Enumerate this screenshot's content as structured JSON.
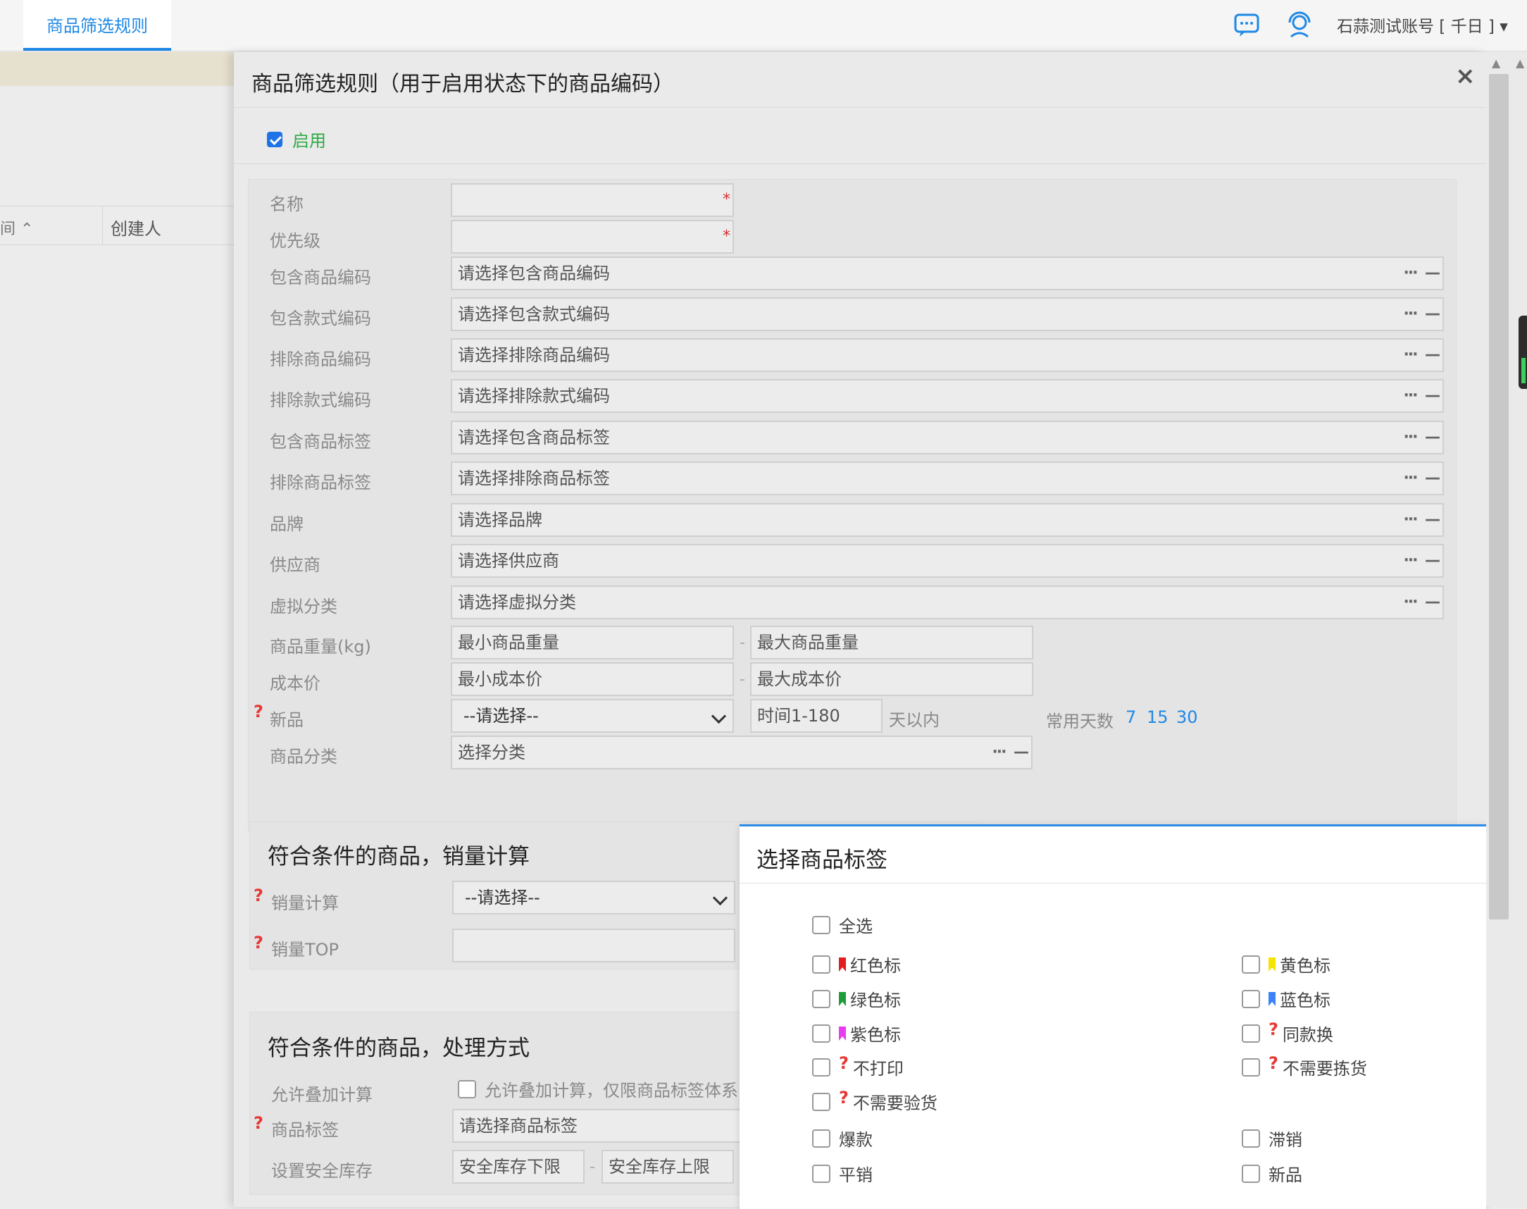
{
  "topbar": {
    "tab_label": "商品筛选规则",
    "user_label": "石蒜测试账号 [ 千日 ]  ▾",
    "icons": [
      "chat-icon",
      "support-icon"
    ]
  },
  "list": {
    "col1": "间",
    "col2": "创建人"
  },
  "dialog": {
    "title": "商品筛选规则（用于启用状态下的商品编码）",
    "close": "×",
    "enabled_label": "启用",
    "enabled": true
  },
  "form": {
    "name_label": "名称",
    "priority_label": "优先级",
    "rows": [
      {
        "label": "包含商品编码",
        "placeholder": "请选择包含商品编码"
      },
      {
        "label": "包含款式编码",
        "placeholder": "请选择包含款式编码"
      },
      {
        "label": "排除商品编码",
        "placeholder": "请选择排除商品编码"
      },
      {
        "label": "排除款式编码",
        "placeholder": "请选择排除款式编码"
      },
      {
        "label": "包含商品标签",
        "placeholder": "请选择包含商品标签"
      },
      {
        "label": "排除商品标签",
        "placeholder": "请选择排除商品标签"
      },
      {
        "label": "品牌",
        "placeholder": "请选择品牌"
      },
      {
        "label": "供应商",
        "placeholder": "请选择供应商"
      },
      {
        "label": "虚拟分类",
        "placeholder": "请选择虚拟分类"
      }
    ],
    "weight_label": "商品重量(kg)",
    "weight_min": "最小商品重量",
    "weight_max": "最大商品重量",
    "cost_label": "成本价",
    "cost_min": "最小成本价",
    "cost_max": "最大成本价",
    "new_label": "新品",
    "new_select": "--请选择--",
    "new_days": "时间1-180",
    "new_days_suffix": "天以内",
    "common_days_label": "常用天数",
    "common_days": [
      "7",
      "15",
      "30"
    ],
    "category_label": "商品分类",
    "category_placeholder": "选择分类",
    "dash": "-",
    "help": "?",
    "req": "*",
    "dots": "···",
    "minus": "—"
  },
  "sales": {
    "title": "符合条件的商品，销量计算",
    "calc_label": "销量计算",
    "calc_select": "--请选择--",
    "top_label": "销量TOP"
  },
  "handling": {
    "title": "符合条件的商品，处理方式",
    "stack_label": "允许叠加计算",
    "stack_text": "允许叠加计算，仅限商品标签体系",
    "tag_label": "商品标签",
    "tag_placeholder": "请选择商品标签",
    "safe_label": "设置安全库存",
    "safe_min": "安全库存下限",
    "safe_max": "安全库存上限"
  },
  "tag_popup": {
    "title": "选择商品标签",
    "select_all": "全选",
    "tags": [
      {
        "label": "红色标",
        "flag": "#e11d1d"
      },
      {
        "label": "黄色标",
        "flag": "#f5e400"
      },
      {
        "label": "绿色标",
        "flag": "#1f9d3a"
      },
      {
        "label": "蓝色标",
        "flag": "#3b82f6"
      },
      {
        "label": "紫色标",
        "flag": "#e83cf0"
      },
      {
        "label": "同款换",
        "help": true
      },
      {
        "label": "不打印",
        "help": true
      },
      {
        "label": "不需要拣货",
        "help": true
      },
      {
        "label": "不需要验货",
        "help": true
      },
      {
        "label": "爆款"
      },
      {
        "label": "滞销"
      },
      {
        "label": "平销"
      },
      {
        "label": "新品"
      }
    ]
  },
  "colors": {
    "accent": "#1e88e5",
    "enabled_green": "#2eaa44",
    "required_red": "#d32f2f"
  }
}
